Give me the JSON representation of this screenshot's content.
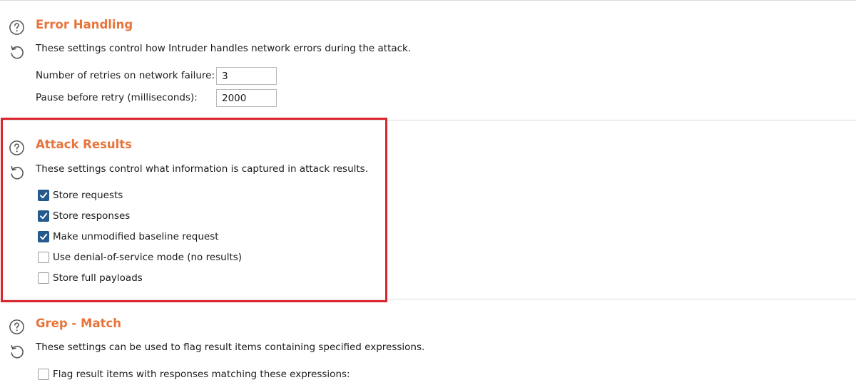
{
  "error_handling": {
    "title": "Error Handling",
    "description": "These settings control how Intruder handles network errors during the attack.",
    "retries_label": "Number of retries on network failure:",
    "retries_value": "3",
    "pause_label": "Pause before retry (milliseconds):",
    "pause_value": "2000"
  },
  "attack_results": {
    "title": "Attack Results",
    "description": "These settings control what information is captured in attack results.",
    "options": [
      {
        "label": "Store requests",
        "checked": true
      },
      {
        "label": "Store responses",
        "checked": true
      },
      {
        "label": "Make unmodified baseline request",
        "checked": true
      },
      {
        "label": "Use denial-of-service mode (no results)",
        "checked": false
      },
      {
        "label": "Store full payloads",
        "checked": false
      }
    ]
  },
  "grep_match": {
    "title": "Grep - Match",
    "description": "These settings can be used to flag result items containing specified expressions.",
    "options": [
      {
        "label": "Flag result items with responses matching these expressions:",
        "checked": false
      }
    ]
  },
  "icons": {
    "help": "help-icon",
    "reset": "reset-icon"
  },
  "colors": {
    "section_title": "#e8743b",
    "checkbox_checked": "#245a8e",
    "highlight_border": "#d9262e"
  }
}
